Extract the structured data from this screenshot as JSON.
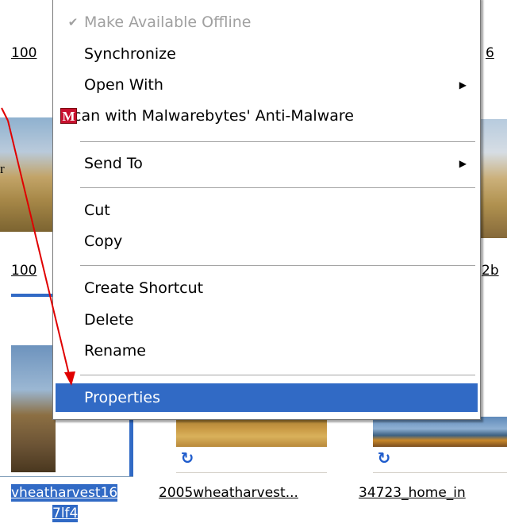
{
  "context_menu": {
    "items": [
      {
        "label": "Make Available Offline",
        "disabled": true,
        "checked": true
      },
      {
        "label": "Synchronize"
      },
      {
        "label": "Open With",
        "submenu": true
      },
      {
        "label": "Scan with Malwarebytes' Anti-Malware",
        "icon": "malwarebytes-icon",
        "icon_letter": "M"
      },
      {
        "label": "Send To",
        "submenu": true
      },
      {
        "label": "Cut"
      },
      {
        "label": "Copy"
      },
      {
        "label": "Create Shortcut"
      },
      {
        "label": "Delete"
      },
      {
        "label": "Rename"
      },
      {
        "label": "Properties",
        "highlighted": true
      }
    ],
    "check_glyph": "✔",
    "submenu_glyph": "▶",
    "highlight_color": "#316ac5"
  },
  "background": {
    "top_left_caption": "100",
    "top_right_caption": "6",
    "mid_left_caption": "100",
    "mid_right_caption": "2b",
    "left_partial_letter": "r",
    "files": [
      {
        "name_line1": "vheatharvest16",
        "name_line2": "7lf4",
        "selected": true
      },
      {
        "name_line1": "2005wheatharvest..."
      },
      {
        "name_line1": "34723_home_in"
      }
    ],
    "sync_overlay_glyph": "↻",
    "selection_color": "#316ac5"
  },
  "annotation": {
    "arrow_color": "#e00000"
  }
}
